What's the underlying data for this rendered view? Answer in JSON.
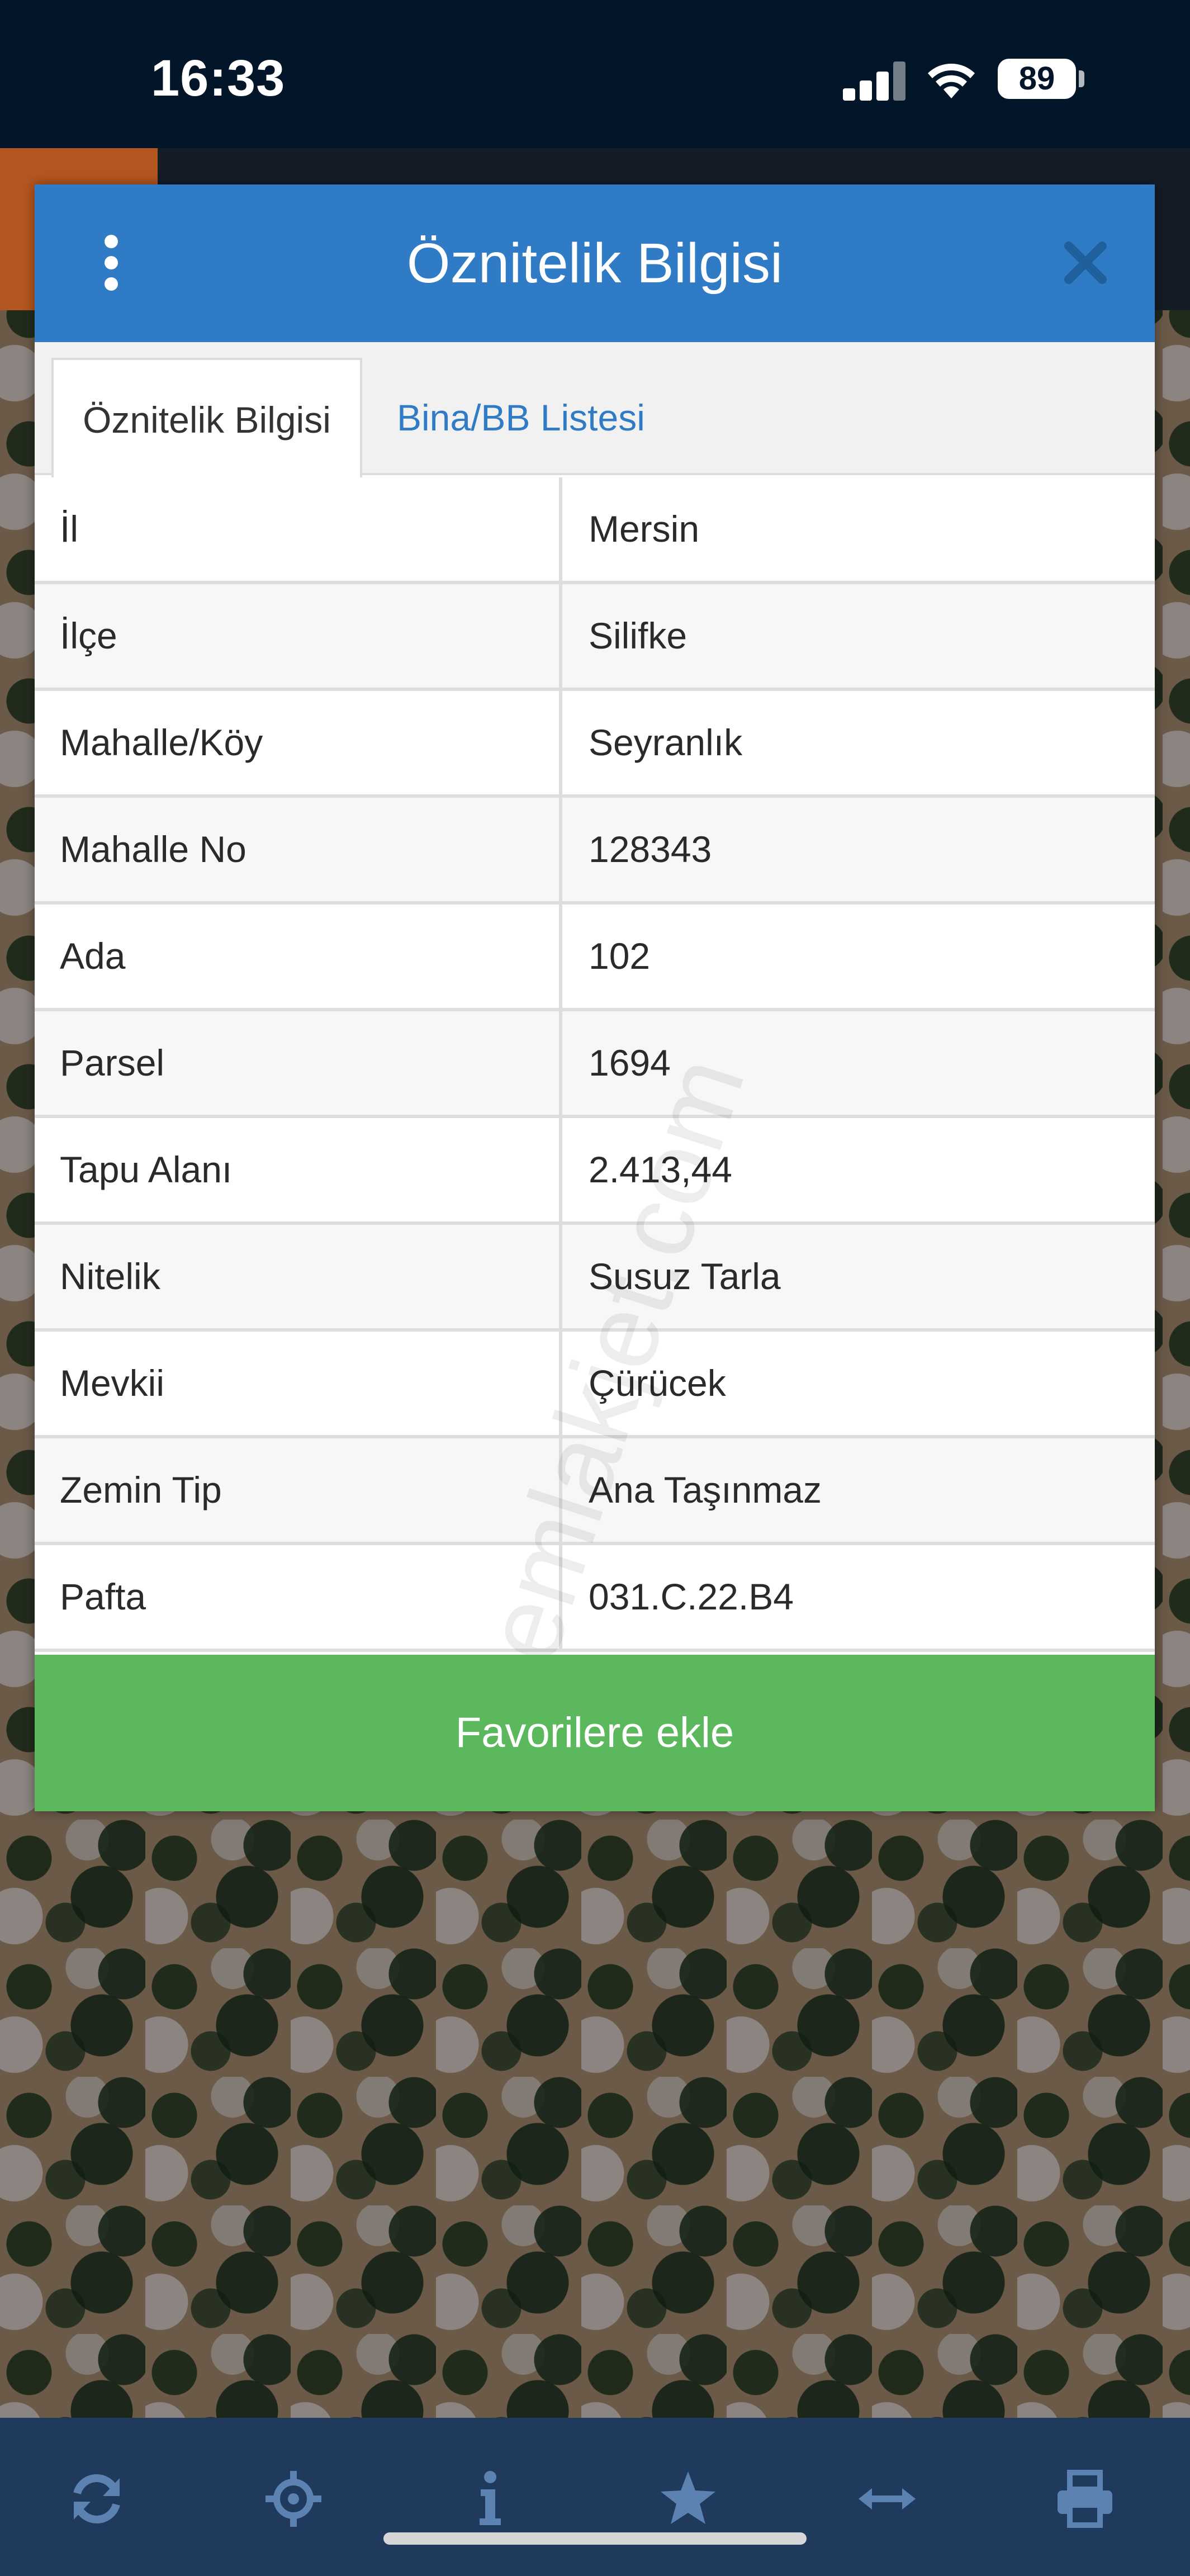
{
  "status_bar": {
    "time": "16:33",
    "battery": "89"
  },
  "dialog": {
    "title": "Öznitelik Bilgisi",
    "tabs": [
      {
        "label": "Öznitelik Bilgisi",
        "active": true
      },
      {
        "label": "Bina/BB Listesi",
        "active": false
      }
    ],
    "rows": [
      {
        "key": "İl",
        "value": "Mersin"
      },
      {
        "key": "İlçe",
        "value": "Silifke"
      },
      {
        "key": "Mahalle/Köy",
        "value": "Seyranlık"
      },
      {
        "key": "Mahalle No",
        "value": "128343"
      },
      {
        "key": "Ada",
        "value": "102"
      },
      {
        "key": "Parsel",
        "value": "1694"
      },
      {
        "key": "Tapu Alanı",
        "value": "2.413,44"
      },
      {
        "key": "Nitelik",
        "value": "Susuz Tarla"
      },
      {
        "key": "Mevkii",
        "value": "Çürücek"
      },
      {
        "key": "Zemin Tip",
        "value": "Ana Taşınmaz"
      },
      {
        "key": "Pafta",
        "value": "031.C.22.B4"
      }
    ],
    "favorite_button": "Favorilere ekle"
  },
  "watermark": "emlakjet.com",
  "toolbar": {
    "icons": [
      "refresh-icon",
      "crosshair-icon",
      "info-icon",
      "star-icon",
      "measure-icon",
      "print-icon"
    ]
  },
  "colors": {
    "header_blue": "#2f7bc5",
    "button_green": "#5cb85c",
    "toolbar_navy": "#1f3a5d",
    "status_bar": "#031528"
  }
}
